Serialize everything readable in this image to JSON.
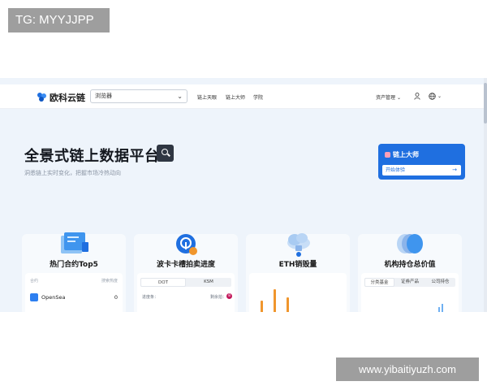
{
  "watermarks": {
    "top": "TG: MYYJJPP",
    "bottom": "www.yibaitiyuzh.com"
  },
  "nav": {
    "logo_text": "欧科云链",
    "browser_select": "浏览器",
    "links": [
      "链上天眼",
      "链上大师",
      "学院"
    ],
    "asset_manage": "资产管理",
    "icons": [
      "user-icon",
      "globe-icon"
    ]
  },
  "hero": {
    "title": "全景式链上数据平台",
    "subtitle": "洞悉链上实时变化，把握市场冷热动向"
  },
  "master_card": {
    "title": "链上大师",
    "button": "开始体验",
    "arrow": "→"
  },
  "cards": [
    {
      "title": "热门合约Top5",
      "col_left": "合约",
      "col_right": "搜索热度",
      "row_name": "OpenSea",
      "row_value": "0"
    },
    {
      "title": "波卡卡槽拍卖进度",
      "tabs": [
        "DOT",
        "KSM"
      ],
      "left_label": "进度条：",
      "right_label": "剩余拍：",
      "badge": "8"
    },
    {
      "title": "ETH销毁量"
    },
    {
      "title": "机构持仓总价值",
      "tabs": [
        "分类基金",
        "证券产品",
        "公司持仓"
      ]
    }
  ],
  "colors": {
    "accent": "#1f6fe0",
    "hero_bg": "#eef4fb",
    "orange": "#f0962d"
  }
}
